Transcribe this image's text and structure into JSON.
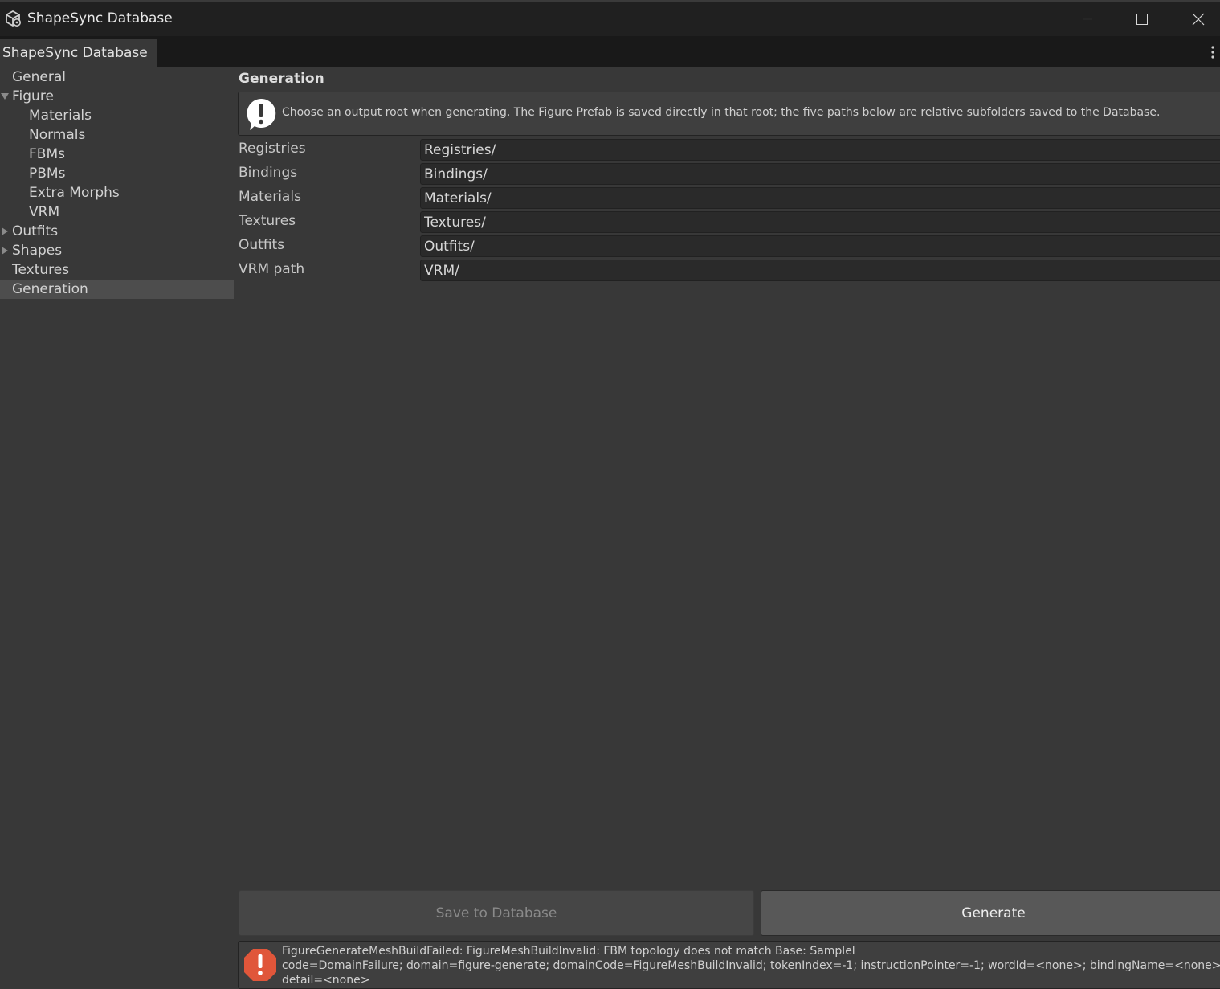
{
  "window": {
    "title": "ShapeSync Database"
  },
  "tab": {
    "label": "ShapeSync Database"
  },
  "sidebar": {
    "items": [
      {
        "label": "General",
        "level": 0,
        "foldout": "none",
        "selected": false
      },
      {
        "label": "Figure",
        "level": 0,
        "foldout": "expanded",
        "selected": false
      },
      {
        "label": "Materials",
        "level": 1,
        "foldout": "none",
        "selected": false
      },
      {
        "label": "Normals",
        "level": 1,
        "foldout": "none",
        "selected": false
      },
      {
        "label": "FBMs",
        "level": 1,
        "foldout": "none",
        "selected": false
      },
      {
        "label": "PBMs",
        "level": 1,
        "foldout": "none",
        "selected": false
      },
      {
        "label": "Extra Morphs",
        "level": 1,
        "foldout": "none",
        "selected": false
      },
      {
        "label": "VRM",
        "level": 1,
        "foldout": "none",
        "selected": false
      },
      {
        "label": "Outfits",
        "level": 0,
        "foldout": "collapsed",
        "selected": false
      },
      {
        "label": "Shapes",
        "level": 0,
        "foldout": "collapsed",
        "selected": false
      },
      {
        "label": "Textures",
        "level": 0,
        "foldout": "none",
        "selected": false
      },
      {
        "label": "Generation",
        "level": 0,
        "foldout": "none",
        "selected": true
      }
    ]
  },
  "main": {
    "section_title": "Generation",
    "help_message": "Choose an output root when generating. The Figure Prefab is saved directly in that root; the five paths below are relative subfolders saved to the Database.",
    "fields": [
      {
        "label": "Registries",
        "value": "Registries/"
      },
      {
        "label": "Bindings",
        "value": "Bindings/"
      },
      {
        "label": "Materials",
        "value": "Materials/"
      },
      {
        "label": "Textures",
        "value": "Textures/"
      },
      {
        "label": "Outfits",
        "value": "Outfits/"
      },
      {
        "label": "VRM path",
        "value": "VRM/"
      }
    ],
    "save_button": "Save to Database",
    "generate_button": "Generate",
    "error_lines": [
      "FigureGenerateMeshBuildFailed: FigureMeshBuildInvalid: FBM topology does not match Base: Samplel",
      "code=DomainFailure; domain=figure-generate; domainCode=FigureMeshBuildInvalid; tokenIndex=-1; instructionPointer=-1; wordId=<none>; bindingName=<none>;",
      "detail=<none>"
    ]
  },
  "colors": {
    "background": "#383838",
    "titlebar": "#202020",
    "selected_row": "#4d4d4d",
    "input_bg": "#2a2a2a",
    "error_icon": "#e0563a",
    "info_icon": "#ffffff"
  }
}
